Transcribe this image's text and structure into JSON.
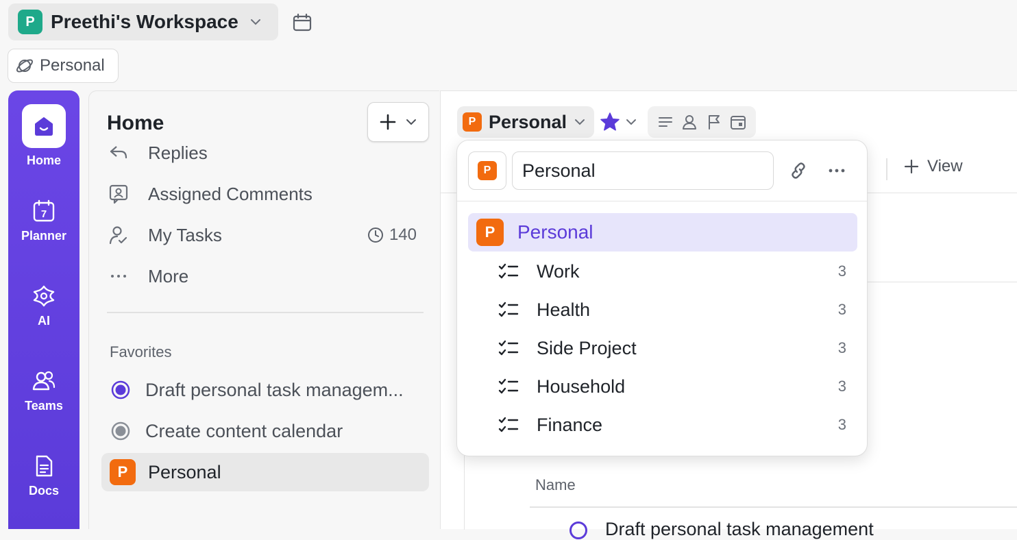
{
  "workspace": {
    "initial": "P",
    "name": "Preethi's Workspace",
    "color": "#1ea98a"
  },
  "space_chip": {
    "label": "Personal"
  },
  "rail": {
    "items": [
      {
        "label": "Home"
      },
      {
        "label": "Planner"
      },
      {
        "label": "AI"
      },
      {
        "label": "Teams"
      },
      {
        "label": "Docs"
      }
    ]
  },
  "sidebar": {
    "title": "Home",
    "nav": [
      {
        "label": "Replies"
      },
      {
        "label": "Assigned Comments"
      },
      {
        "label": "My Tasks",
        "count": "140"
      },
      {
        "label": "More"
      }
    ],
    "favorites_label": "Favorites",
    "favorites": [
      {
        "label": "Draft personal task managem..."
      },
      {
        "label": "Create content calendar"
      },
      {
        "label": "Personal",
        "initial": "P"
      }
    ]
  },
  "main": {
    "breadcrumb": {
      "initial": "P",
      "label": "Personal"
    },
    "add_view_label": "View",
    "name_header": "Name",
    "row_text": "Draft personal task management"
  },
  "popover": {
    "initial": "P",
    "input_value": "Personal",
    "selected": {
      "initial": "P",
      "label": "Personal"
    },
    "lists": [
      {
        "label": "Work",
        "count": "3"
      },
      {
        "label": "Health",
        "count": "3"
      },
      {
        "label": "Side Project",
        "count": "3"
      },
      {
        "label": "Household",
        "count": "3"
      },
      {
        "label": "Finance",
        "count": "3"
      }
    ]
  },
  "colors": {
    "accent": "#5b3bd9",
    "orange": "#f26b0f",
    "rail": "#6b46e6"
  }
}
